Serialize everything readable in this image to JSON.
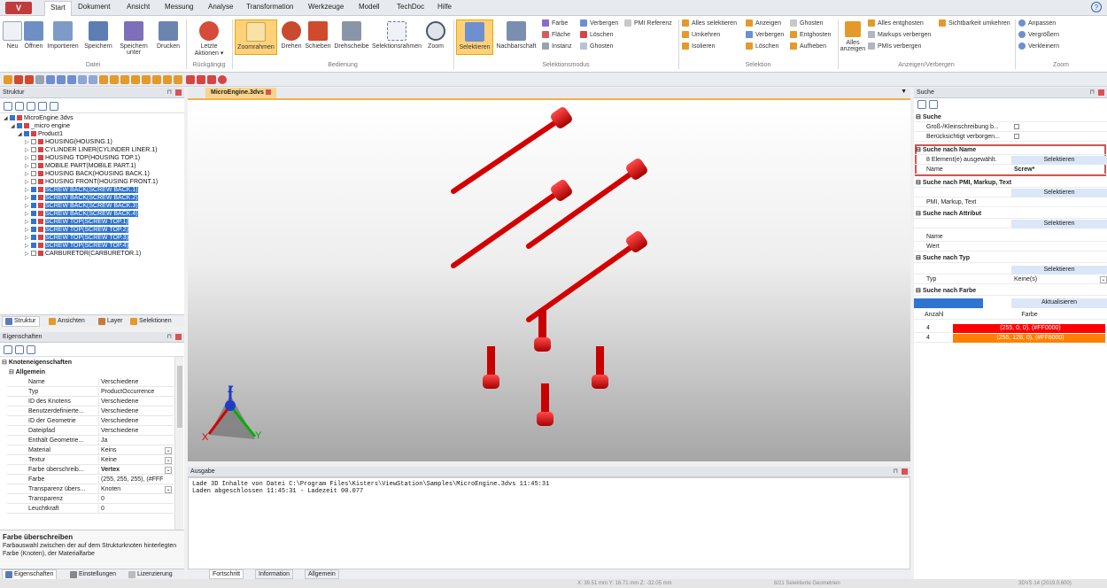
{
  "menu": {
    "logo": "V",
    "tabs": [
      "Start",
      "Dokument",
      "Ansicht",
      "Messung",
      "Analyse",
      "Transformation",
      "Werkzeuge",
      "Modell",
      "TechDoc",
      "Hilfe"
    ],
    "help": "?"
  },
  "ribbon": {
    "datei": {
      "label": "Datei",
      "items": [
        "Neu",
        "Öffnen",
        "Importieren",
        "Speichern",
        "Speichern unter",
        "Drucken"
      ]
    },
    "rueck": {
      "label": "Rückgängig",
      "items": [
        "Letzte Aktionen ▾"
      ]
    },
    "bedienung": {
      "label": "Bedienung",
      "items": [
        "Zoomrahmen",
        "Drehen",
        "Schieben",
        "Drehscheibe",
        "Selektionsrahmen",
        "Zoom"
      ]
    },
    "selmodus": {
      "label": "Selektionsmodus",
      "items": [
        "Selektieren",
        "Nachbarschaft"
      ],
      "small": [
        "Farbe",
        "Verbergen",
        "PMI Referenz",
        "Fläche",
        "Löschen",
        "Instanz",
        "Ghosten"
      ]
    },
    "selektion": {
      "label": "Selektion",
      "small": [
        "Alles selektieren",
        "Anzeigen",
        "Ghosten",
        "Umkehren",
        "Verbergen",
        "Entghosten",
        "Isolieren",
        "Löschen",
        "Aufheben"
      ]
    },
    "anzeigen": {
      "label": "Anzeigen/Verbergen",
      "big": "Alles anzeigen",
      "small": [
        "Alles entghosten",
        "Sichtbarkeit umkehren",
        "Markups verbergen",
        "PMIs verbergen"
      ]
    },
    "zoom": {
      "label": "Zoom",
      "small": [
        "Anpassen",
        "Vergrößern",
        "Verkleinern"
      ]
    }
  },
  "struktur": {
    "title": "Struktur",
    "tree": [
      {
        "label": "MicroEngine.3dvs",
        "indent": 0,
        "sel": false,
        "cb": false
      },
      {
        "label": "_micro engine",
        "indent": 1,
        "sel": false,
        "cb": false
      },
      {
        "label": "Product1",
        "indent": 2,
        "sel": false,
        "cb": false
      },
      {
        "label": "HOUSING(HOUSING.1)",
        "indent": 3,
        "sel": false,
        "cb": false
      },
      {
        "label": "CYLINDER LINER(CYLINDER LINER.1)",
        "indent": 3,
        "sel": false,
        "cb": false
      },
      {
        "label": "HOUSING TOP(HOUSING TOP.1)",
        "indent": 3,
        "sel": false,
        "cb": false
      },
      {
        "label": "MOBILE PART(MOBILE PART.1)",
        "indent": 3,
        "sel": false,
        "cb": false
      },
      {
        "label": "HOUSING BACK(HOUSING BACK.1)",
        "indent": 3,
        "sel": false,
        "cb": false
      },
      {
        "label": "HOUSING FRONT(HOUSING FRONT.1)",
        "indent": 3,
        "sel": false,
        "cb": false
      },
      {
        "label": "SCREW BACK(SCREW BACK.1)",
        "indent": 3,
        "sel": true,
        "cb": true
      },
      {
        "label": "SCREW BACK(SCREW BACK.2)",
        "indent": 3,
        "sel": true,
        "cb": true
      },
      {
        "label": "SCREW BACK(SCREW BACK.3)",
        "indent": 3,
        "sel": true,
        "cb": true
      },
      {
        "label": "SCREW BACK(SCREW BACK.4)",
        "indent": 3,
        "sel": true,
        "cb": true
      },
      {
        "label": "SCREW TOP(SCREW TOP.1)",
        "indent": 3,
        "sel": true,
        "cb": true
      },
      {
        "label": "SCREW TOP(SCREW TOP.2)",
        "indent": 3,
        "sel": true,
        "cb": true
      },
      {
        "label": "SCREW TOP(SCREW TOP.3)",
        "indent": 3,
        "sel": true,
        "cb": true
      },
      {
        "label": "SCREW TOP(SCREW TOP.4)",
        "indent": 3,
        "sel": true,
        "cb": true
      },
      {
        "label": "CARBURETOR(CARBURETOR.1)",
        "indent": 3,
        "sel": false,
        "cb": false
      }
    ],
    "tabs": [
      "Struktur",
      "Ansichten",
      "Layer",
      "Selektionen"
    ]
  },
  "props": {
    "title": "Eigenschaften",
    "section": "Knoteneigenschaften",
    "group": "Allgemein",
    "rows": [
      {
        "k": "Name",
        "v": "Verschiedene"
      },
      {
        "k": "Typ",
        "v": "ProductOccurrence"
      },
      {
        "k": "ID des Knotens",
        "v": "Verschiedene"
      },
      {
        "k": "Benutzerdefinierte...",
        "v": "Verschiedene"
      },
      {
        "k": "ID der Geometrie",
        "v": "Verschiedene"
      },
      {
        "k": "Dateipfad",
        "v": "Verschiedene"
      },
      {
        "k": "Enthält Geometrie...",
        "v": "Ja"
      },
      {
        "k": "Material",
        "v": "Keins"
      },
      {
        "k": "Textur",
        "v": "Keine"
      },
      {
        "k": "Farbe überschreib...",
        "v": "Vertex"
      },
      {
        "k": "Farbe",
        "v": "(255, 255, 255), (#FFF"
      },
      {
        "k": "Transparenz übers...",
        "v": "Knoten"
      },
      {
        "k": "Transparenz",
        "v": "0"
      },
      {
        "k": "Leuchtkraft",
        "v": "0"
      }
    ],
    "help_title": "Farbe überschreiben",
    "help_text": "Farbauswahl zwischen der auf dem Strukturknoten hinterlegten Farbe (Knoten), der Materialfarbe",
    "tabs": [
      "Eigenschaften",
      "Einstellungen",
      "Lizenzierung"
    ]
  },
  "doc": {
    "tab": "MicroEngine.3dvs"
  },
  "axes": {
    "x": "X",
    "y": "Y",
    "z": "Z"
  },
  "output": {
    "title": "Ausgabe",
    "lines": [
      "Lade 3D Inhalte von Datei C:\\Program Files\\Kisters\\ViewStation\\Samples\\MicroEngine.3dvs 11:45:31",
      "Laden abgeschlossen 11:45:31 - Ladezeit 00.077"
    ],
    "tabs": [
      "Fortschritt",
      "Information",
      "Allgemein"
    ]
  },
  "suche": {
    "title": "Suche",
    "group1": "Suche",
    "case": "Groß-/Kleinschreibung b...",
    "hidden": "Berücksichtigt verborgen...",
    "byname": "Suche nach Name",
    "count": "8 Element(e) ausgewählt.",
    "select": "Selektieren",
    "name_k": "Name",
    "name_v": "Screw*",
    "bypmi": "Suche nach PMI, Markup, Text",
    "pmi_k": "PMI, Markup, Text",
    "byattr": "Suche nach Attribut",
    "attr_name": "Name",
    "attr_wert": "Wert",
    "bytype": "Suche nach Typ",
    "type_k": "Typ",
    "type_v": "Keine(s)",
    "bycolor": "Suche nach Farbe",
    "refresh": "Aktualisieren",
    "col_count": "Anzahl",
    "col_color": "Farbe",
    "colors": [
      {
        "n": "4",
        "label": "(255, 0, 0), (#FF0000)",
        "hex": "#ff0000"
      },
      {
        "n": "4",
        "label": "(255, 128, 0), (#FF8000)",
        "hex": "#ff8000"
      }
    ]
  },
  "status": {
    "coords": "X: 39.51 mm  Y: 16.71 mm  Z: -32.05 mm",
    "sel": "8/21 Selektierte Geometrien",
    "version": "3DVS 14 (2019.0.600)"
  }
}
